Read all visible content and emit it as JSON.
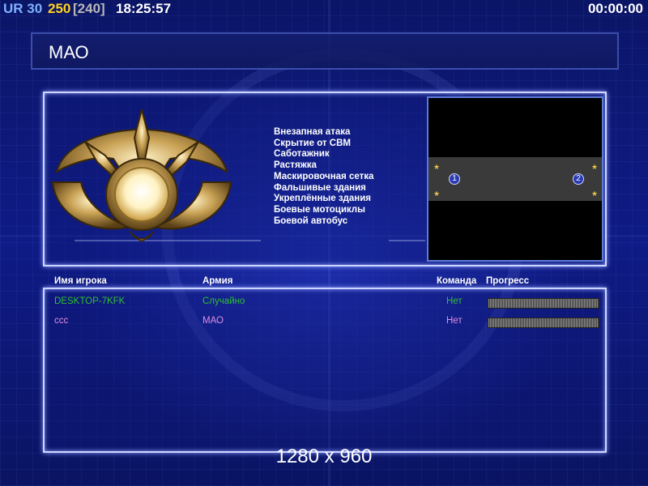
{
  "hud": {
    "ur_label": "UR",
    "ur_value": "30",
    "money": "250",
    "money_cap": "[240]",
    "clock": "18:25:57",
    "timer": "00:00:00"
  },
  "screen_title": "МАО",
  "emblem_icon": "faction-emblem-icon",
  "features": [
    "Внезапная атака",
    "Скрытие от СВМ",
    "Саботажник",
    "Растяжка",
    "Маскировочная сетка",
    "Фальшивые здания",
    "Укреплённые здания",
    "Боевые мотоциклы",
    "Боевой автобус"
  ],
  "map": {
    "slot1": "1",
    "slot2": "2"
  },
  "columns": {
    "player": "Имя игрока",
    "army": "Армия",
    "team": "Команда",
    "progress": "Прогресс"
  },
  "players": [
    {
      "name": "DESKTOP-7KFK",
      "army": "Случайно",
      "team": "Нет",
      "color": "#2fbf2f",
      "progress": 1.0
    },
    {
      "name": "ccc",
      "army": "МАО",
      "team": "Нет",
      "color": "#e08ee0",
      "progress": 1.0
    }
  ],
  "resolution": "1280 x 960"
}
